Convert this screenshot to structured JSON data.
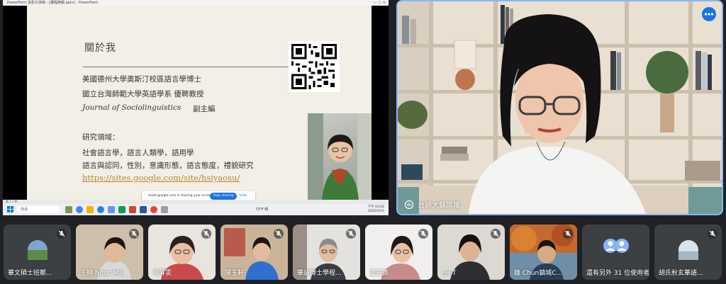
{
  "share": {
    "window_title": "PowerPoint 投影片放映 - [課程簡報.pptx] - PowerPoint",
    "slide": {
      "title": "關於我",
      "lines": [
        "美國德州大學奧斯汀校區語言學博士",
        "國立台灣師範大學英語學系 優聘教授",
        "Journal of Sociolinguistics",
        "副主編",
        "研究領域：",
        "社會語言學，語言人類學，語用學",
        "語言與認同，性別，意識形態，語言態度，禮貌研究"
      ],
      "link": "https://sites.google.com/site/hsiyaosu/"
    },
    "sharing_bar": {
      "message": "meet.google.com is sharing your screen.",
      "stop_label": "Stop sharing",
      "hide_label": "Hide"
    },
    "status": "第 1 / 45",
    "taskbar": {
      "search_placeholder": "搜尋",
      "weather": "73°F 晴",
      "clock_time": "下午 03:02",
      "clock_date": "2025/4/15"
    }
  },
  "speaker": {
    "name": "台師大蘇席瑤"
  },
  "participants": [
    {
      "name": "華文碩士班鄭..."
    },
    {
      "name": "王柳 Ngoc Mai"
    },
    {
      "name": "柯屏雯"
    },
    {
      "name": "陳玉軒"
    },
    {
      "name": "華語博士學程..."
    },
    {
      "name": "盧宣菁"
    },
    {
      "name": "PH T"
    },
    {
      "name": "雄 Chun鎮城C..."
    },
    {
      "name": "還有另外 31 位使用者"
    },
    {
      "name": "胡氏秋玄華語..."
    }
  ],
  "colors": {
    "accent": "#1a73e8",
    "active_border": "#8ab4f8",
    "background": "#202124",
    "tile": "#3c4043",
    "link": "#b8892b"
  }
}
